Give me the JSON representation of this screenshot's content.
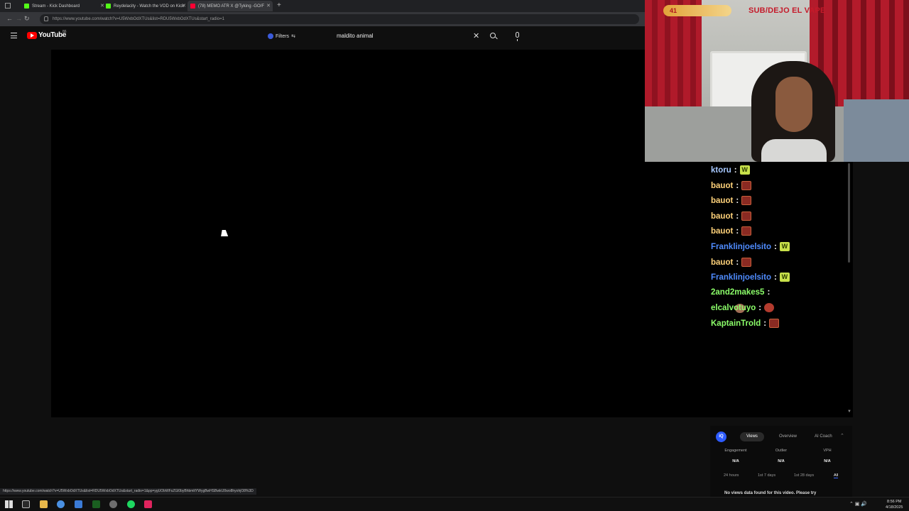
{
  "browser": {
    "tabs": [
      {
        "title": "Stream - Kick Dashboard",
        "favicon_color": "#53fc18",
        "active": false
      },
      {
        "title": "Reydelacity - Watch the VOD on Kick",
        "favicon_color": "#53fc18",
        "active": false
      },
      {
        "title": "(78) MEMO ATR X @Tyking -GO/F",
        "favicon_color": "#ff0033",
        "active": true
      }
    ],
    "url": "https://www.youtube.com/watch?v=U5WxbOdXTUs&list=RDU5WxbOdXTUs&start_radio=1",
    "status_url": "https://www.youtube.com/watch?v=U5WxbOdXTUs&list=RDU5WxbOdXTUs&start_radio=1&pp=ygUObWFsZGl0byBhbmltYWygBwHSBwkIJ0wo8hyohjO8%3D"
  },
  "youtube": {
    "logo_text": "YouTube",
    "logo_sup": "86",
    "filters_label": "Filters",
    "search_value": "maldito animal"
  },
  "overlay": {
    "sub_count": "41",
    "banner_text": "SUB/DEJO EL VAPE"
  },
  "chat": {
    "messages": [
      {
        "user": "ktoru",
        "color": "#a7c8ff",
        "emote": "w"
      },
      {
        "user": "bauot",
        "color": "#ffd27a",
        "emote": "red"
      },
      {
        "user": "bauot",
        "color": "#ffd27a",
        "emote": "red"
      },
      {
        "user": "bauot",
        "color": "#ffd27a",
        "emote": "red"
      },
      {
        "user": "bauot",
        "color": "#ffd27a",
        "emote": "red"
      },
      {
        "user": "Franklinjoelsito",
        "color": "#4f8cff",
        "emote": "w"
      },
      {
        "user": "bauot",
        "color": "#ffd27a",
        "emote": "red"
      },
      {
        "user": "Franklinjoelsito",
        "color": "#4f8cff",
        "emote": "w"
      },
      {
        "user": "2and2makes5",
        "color": "#8cff6a",
        "emote": "face"
      },
      {
        "user": "elcalvotuyo",
        "color": "#8cff6a",
        "emote": "gnome"
      },
      {
        "user": "KaptainTrold",
        "color": "#8cff6a",
        "emote": "red"
      }
    ]
  },
  "analytics": {
    "logo": "iQ",
    "tabs": [
      "Views",
      "Overview",
      "AI Coach"
    ],
    "active_tab": "Views",
    "metrics": [
      {
        "label": "Engagement",
        "value": "N/A"
      },
      {
        "label": "Outlier",
        "value": "N/A"
      },
      {
        "label": "VPH",
        "value": "N/A"
      }
    ],
    "ranges": [
      "24 hours",
      "1st 7 days",
      "1st 28 days",
      "All"
    ],
    "active_range": "All",
    "empty_message": "No views data found for this video. Please try"
  },
  "taskbar": {
    "time": "8:56 PM",
    "date": "4/18/2025"
  }
}
